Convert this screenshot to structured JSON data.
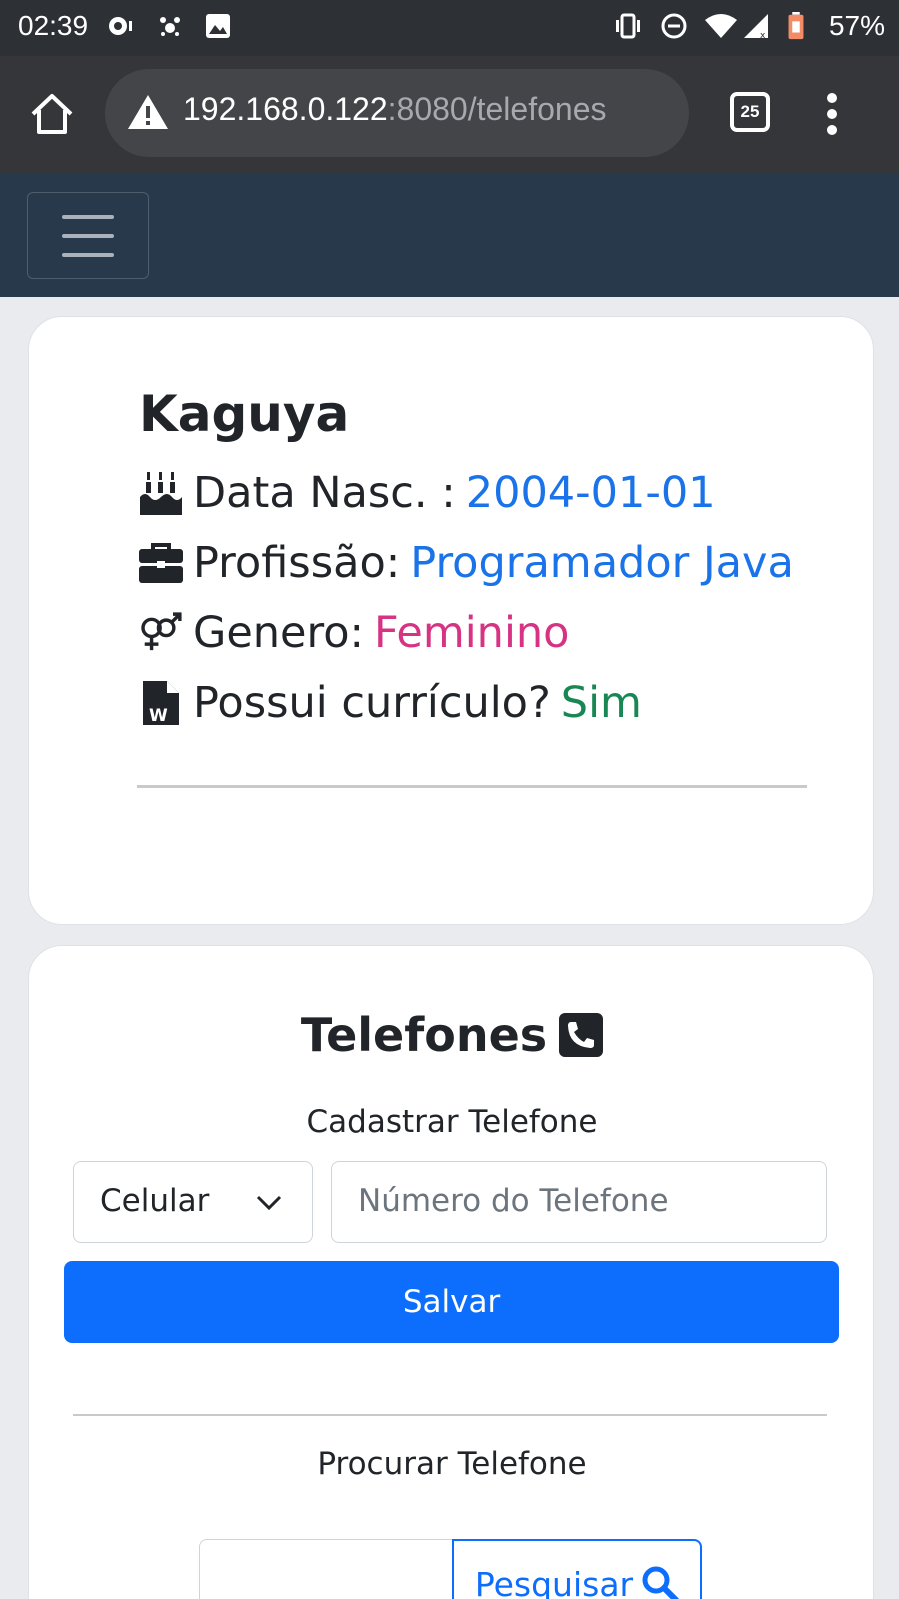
{
  "status_bar": {
    "time": "02:39",
    "battery": "57%"
  },
  "browser": {
    "url_host": "192.168.0.122",
    "url_rest": ":8080/telefones",
    "tab_count": "25"
  },
  "profile": {
    "name": "Kaguya",
    "birth_label": "Data Nasc. :",
    "birth_value": "2004-01-01",
    "profession_label": "Profissão:",
    "profession_value": "Programador Java",
    "gender_label": "Genero:",
    "gender_value": "Feminino",
    "resume_label": "Possui currículo?",
    "resume_value": "Sim"
  },
  "phones": {
    "title": "Telefones",
    "register_label": "Cadastrar Telefone",
    "type_selected": "Celular",
    "number_placeholder": "Número do Telefone",
    "save_label": "Salvar",
    "search_label": "Procurar Telefone",
    "search_button": "Pesquisar"
  },
  "colors": {
    "accent": "#0d6efd",
    "navbar": "#29394c",
    "link_blue": "#1a73e8",
    "pink": "#d63384",
    "green": "#198754"
  },
  "icons": {
    "birthday": "birthday-cake-icon",
    "profession": "briefcase-icon",
    "gender": "venus-mars-icon",
    "resume": "word-file-icon",
    "phone": "phone-square-icon",
    "search": "search-icon"
  }
}
